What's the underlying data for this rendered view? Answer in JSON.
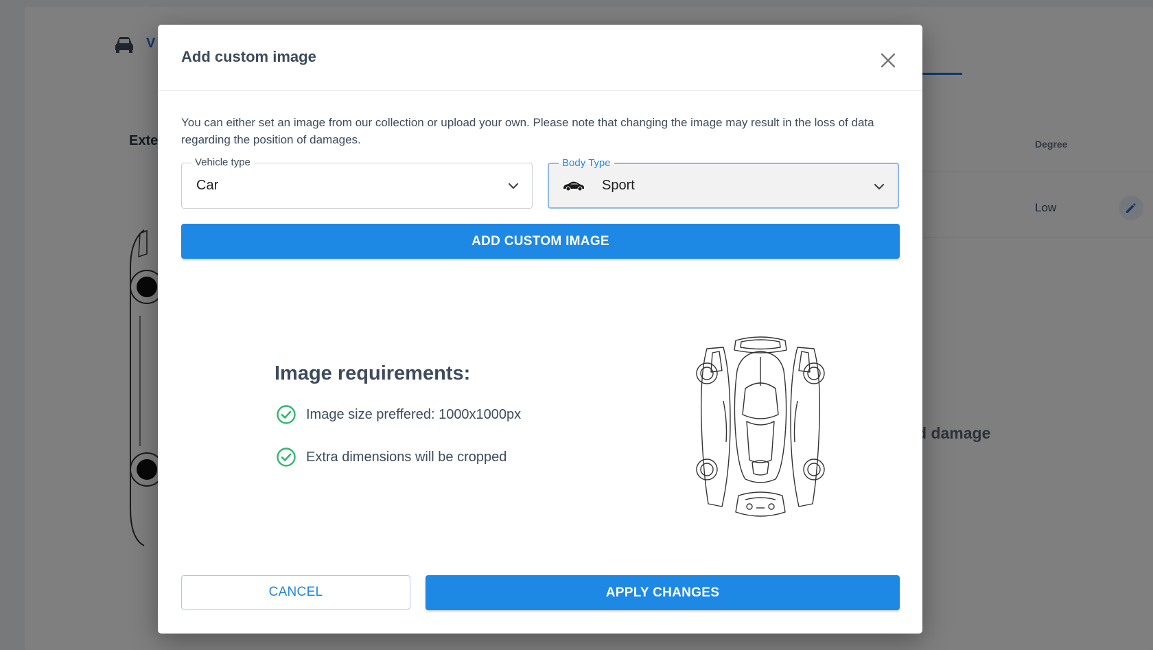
{
  "background": {
    "tab_label": "V",
    "section_title": "Exte",
    "degree_header": "Degree",
    "degree_value": "Low",
    "damage_text": "d damage",
    "icons": {
      "vehicle": "car-icon",
      "edit": "pencil-icon"
    }
  },
  "modal": {
    "title": "Add custom image",
    "close_icon": "close-icon",
    "description": "You can either set an image from our collection or upload your own. Please note that changing the image may result in the loss of data regarding the position of damages.",
    "vehicle_type": {
      "label": "Vehicle type",
      "value": "Car"
    },
    "body_type": {
      "label": "Body Type",
      "value": "Sport",
      "icon": "sport-car-icon"
    },
    "add_image_label": "ADD CUSTOM IMAGE",
    "requirements": {
      "title": "Image requirements:",
      "items": [
        "Image size preffered: 1000x1000px",
        "Extra dimensions will be cropped"
      ],
      "icon": "check-circle-icon"
    },
    "cancel_label": "CANCEL",
    "apply_label": "APPLY CHANGES"
  },
  "colors": {
    "primary": "#1e88e5",
    "success": "#2fb86b",
    "text": "#3d4b5c",
    "overlay": "rgba(0,0,0,0.5)"
  }
}
